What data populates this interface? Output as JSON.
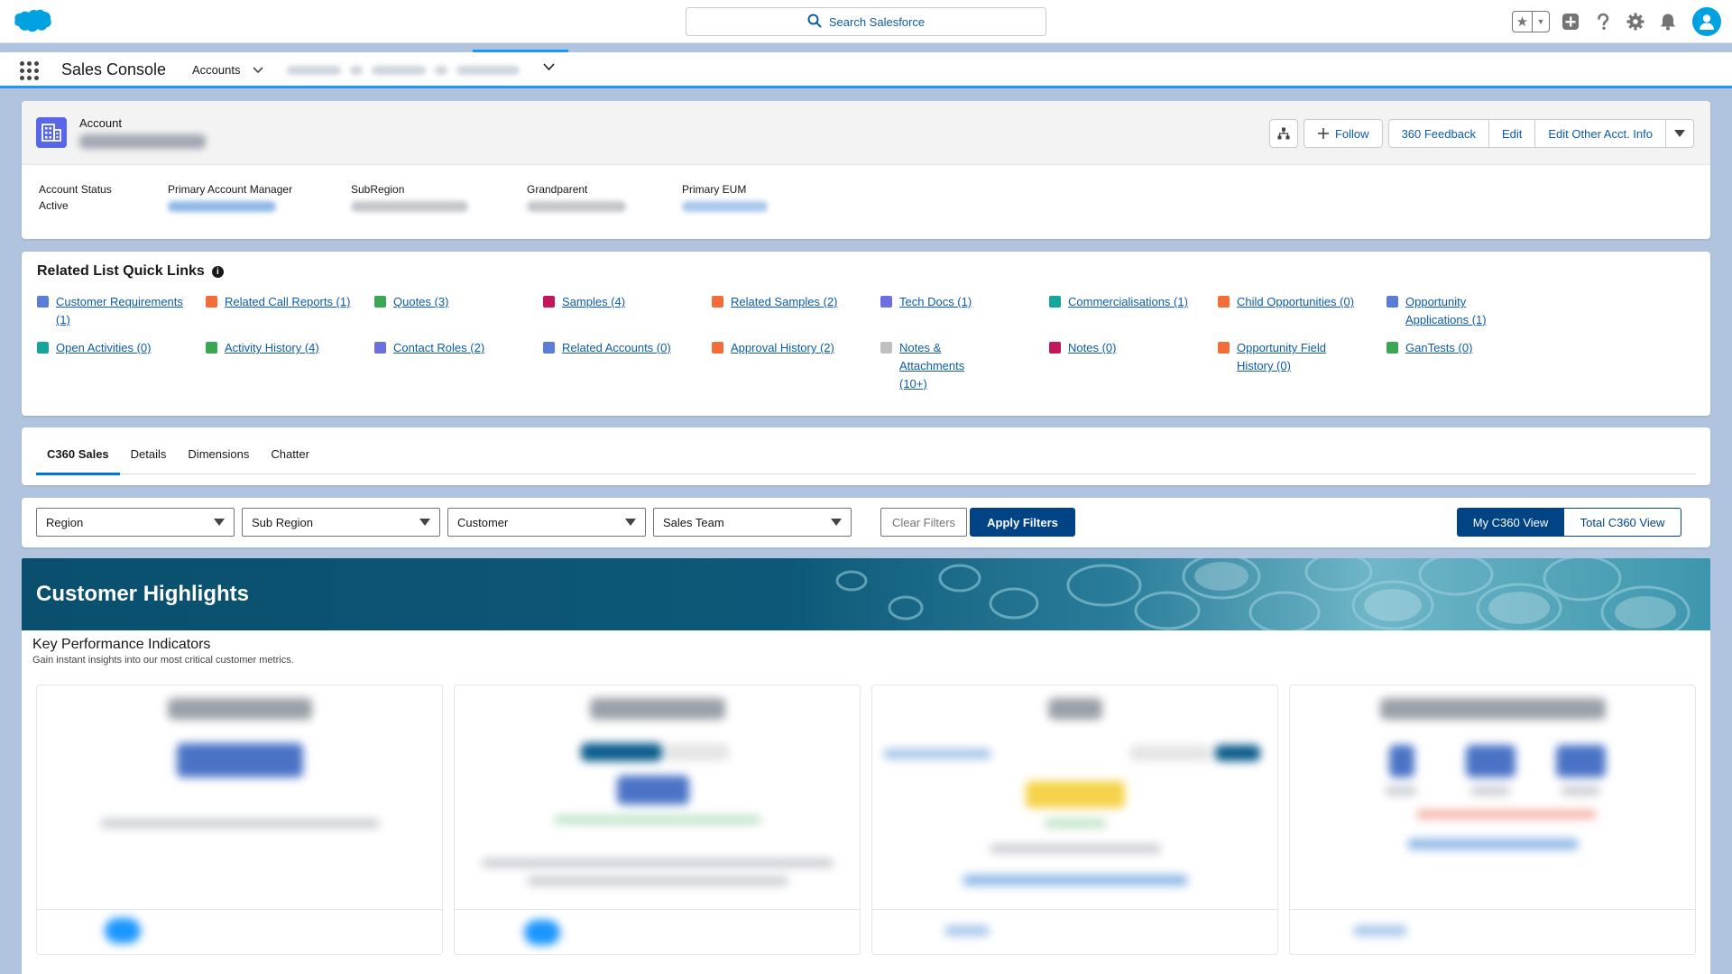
{
  "global_header": {
    "search_placeholder": "Search Salesforce"
  },
  "app_nav": {
    "app_name": "Sales Console",
    "nav_item": "Accounts"
  },
  "record": {
    "type_label": "Account",
    "actions": {
      "follow": "Follow",
      "feedback": "360 Feedback",
      "edit": "Edit",
      "edit_other": "Edit Other Acct. Info"
    },
    "fields": [
      {
        "label": "Account Status",
        "value": "Active"
      },
      {
        "label": "Primary Account Manager",
        "value": ""
      },
      {
        "label": "SubRegion",
        "value": ""
      },
      {
        "label": "Grandparent",
        "value": ""
      },
      {
        "label": "Primary EUM",
        "value": ""
      }
    ]
  },
  "quick_links": {
    "title": "Related List Quick Links",
    "row1": [
      {
        "label": "Customer Requirements (1)",
        "color": "#5a7ed6"
      },
      {
        "label": "Related Call Reports (1)",
        "color": "#f26d3a"
      },
      {
        "label": "Quotes (3)",
        "color": "#3ba755"
      },
      {
        "label": "Samples (4)",
        "color": "#c2185b"
      },
      {
        "label": "Related Samples (2)",
        "color": "#f26d3a"
      },
      {
        "label": "Tech Docs (1)",
        "color": "#6c6fe0"
      },
      {
        "label": "Commercialisations (1)",
        "color": "#16a59a"
      },
      {
        "label": "Child Opportunities (0)",
        "color": "#f26d3a"
      },
      {
        "label": "Opportunity Applications (1)",
        "color": "#5a7ed6"
      }
    ],
    "row2": [
      {
        "label": "Open Activities (0)",
        "color": "#16a59a"
      },
      {
        "label": "Activity History (4)",
        "color": "#3ba755"
      },
      {
        "label": "Contact Roles (2)",
        "color": "#6c6fe0"
      },
      {
        "label": "Related Accounts (0)",
        "color": "#5a7ed6"
      },
      {
        "label": "Approval History (2)",
        "color": "#f26d3a"
      },
      {
        "label": "Notes & Attachments (10+)",
        "color": "#c0c0c0"
      },
      {
        "label": "Notes (0)",
        "color": "#c2185b"
      },
      {
        "label": "Opportunity Field History (0)",
        "color": "#f26d3a"
      },
      {
        "label": "GanTests (0)",
        "color": "#3ba755"
      }
    ]
  },
  "tabs": [
    "C360 Sales",
    "Details",
    "Dimensions",
    "Chatter"
  ],
  "filters": {
    "region": "Region",
    "sub_region": "Sub Region",
    "customer": "Customer",
    "sales_team": "Sales Team",
    "clear": "Clear Filters",
    "apply": "Apply Filters",
    "my_view": "My C360 View",
    "total_view": "Total C360 View"
  },
  "highlights": {
    "title": "Customer Highlights",
    "kpi_title": "Key Performance Indicators",
    "kpi_subtitle": "Gain instant insights into our most critical customer metrics."
  }
}
